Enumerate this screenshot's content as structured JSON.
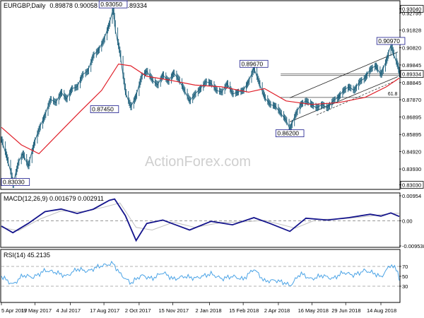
{
  "header": {
    "symbol": "EURGBP,Daily",
    "ohlc": "0.89878 0.90058 0.89125 0.89334"
  },
  "watermark": "ActionForex.com",
  "colors": {
    "background": "#ffffff",
    "bar": "#1b5e7a",
    "ema": "#e0202a",
    "macd_line": "#14148c",
    "macd_signal": "#c0c0c0",
    "rsi_line": "#4aa3e6",
    "trend": "#222222",
    "frame": "#000000",
    "text": "#000000",
    "label_box_border": "#1a1a8c"
  },
  "chart_data": [
    {
      "type": "candlestick",
      "title": "EURGBP,Daily",
      "ylim": [
        0.8285,
        0.9342
      ],
      "y_ticks": [
        "0.93040",
        "0.92795",
        "0.91828",
        "0.90820",
        "0.89845",
        "0.88845",
        "0.87870",
        "0.86895",
        "0.85895",
        "0.84920",
        "0.83930",
        "0.83030"
      ],
      "highlight_ticks": [
        "0.93040",
        "0.89334",
        "0.83030"
      ],
      "last_price": "0.89334",
      "annotations": [
        {
          "label": "0.93050",
          "date": "2017-08-29",
          "value": 0.9305
        },
        {
          "label": "0.87450",
          "date": "2017-09-07",
          "value": 0.8745
        },
        {
          "label": "0.89670",
          "date": "2018-03-01",
          "value": 0.8967
        },
        {
          "label": "0.86200",
          "date": "2018-04-17",
          "value": 0.862
        },
        {
          "label": "0.90970",
          "date": "2018-08-27",
          "value": 0.9097
        },
        {
          "label": "61.8",
          "date": "2018-09-05",
          "value": 0.88
        },
        {
          "label": "0.83030",
          "date": "2017-04-10",
          "value": 0.8303
        }
      ],
      "x_labels": [
        "5 Apr 2017",
        "19 May 2017",
        "4 Jul 2017",
        "17 Aug 2017",
        "2 Oct 2017",
        "15 Nov 2017",
        "2 Jan 2018",
        "15 Feb 2018",
        "2 Apr 2018",
        "16 May 2018",
        "29 Jun 2018",
        "14 Aug 2018"
      ],
      "x_range": [
        "2017-04-05",
        "2018-09-07"
      ],
      "series": [
        {
          "name": "Price",
          "points": [
            [
              "2017-04-05",
              0.856
            ],
            [
              "2017-04-10",
              0.849
            ],
            [
              "2017-04-17",
              0.838
            ],
            [
              "2017-04-20",
              0.8303
            ],
            [
              "2017-04-27",
              0.843
            ],
            [
              "2017-05-03",
              0.848
            ],
            [
              "2017-05-10",
              0.841
            ],
            [
              "2017-05-17",
              0.853
            ],
            [
              "2017-05-24",
              0.862
            ],
            [
              "2017-06-01",
              0.87
            ],
            [
              "2017-06-08",
              0.879
            ],
            [
              "2017-06-15",
              0.877
            ],
            [
              "2017-06-22",
              0.883
            ],
            [
              "2017-06-29",
              0.879
            ],
            [
              "2017-07-06",
              0.885
            ],
            [
              "2017-07-13",
              0.886
            ],
            [
              "2017-07-20",
              0.893
            ],
            [
              "2017-07-27",
              0.895
            ],
            [
              "2017-08-03",
              0.904
            ],
            [
              "2017-08-10",
              0.907
            ],
            [
              "2017-08-17",
              0.913
            ],
            [
              "2017-08-24",
              0.922
            ],
            [
              "2017-08-29",
              0.9305
            ],
            [
              "2017-09-01",
              0.918
            ],
            [
              "2017-09-07",
              0.905
            ],
            [
              "2017-09-14",
              0.883
            ],
            [
              "2017-09-21",
              0.8745
            ],
            [
              "2017-09-28",
              0.881
            ],
            [
              "2017-10-05",
              0.892
            ],
            [
              "2017-10-12",
              0.895
            ],
            [
              "2017-10-19",
              0.89
            ],
            [
              "2017-10-26",
              0.887
            ],
            [
              "2017-11-02",
              0.893
            ],
            [
              "2017-11-09",
              0.889
            ],
            [
              "2017-11-16",
              0.894
            ],
            [
              "2017-11-23",
              0.89
            ],
            [
              "2017-11-30",
              0.884
            ],
            [
              "2017-12-07",
              0.878
            ],
            [
              "2017-12-14",
              0.882
            ],
            [
              "2017-12-21",
              0.885
            ],
            [
              "2017-12-28",
              0.889
            ],
            [
              "2018-01-04",
              0.888
            ],
            [
              "2018-01-11",
              0.884
            ],
            [
              "2018-01-18",
              0.883
            ],
            [
              "2018-01-25",
              0.888
            ],
            [
              "2018-02-01",
              0.882
            ],
            [
              "2018-02-08",
              0.883
            ],
            [
              "2018-02-15",
              0.884
            ],
            [
              "2018-02-22",
              0.889
            ],
            [
              "2018-03-01",
              0.8967
            ],
            [
              "2018-03-08",
              0.888
            ],
            [
              "2018-03-15",
              0.88
            ],
            [
              "2018-03-22",
              0.876
            ],
            [
              "2018-03-29",
              0.875
            ],
            [
              "2018-04-05",
              0.871
            ],
            [
              "2018-04-12",
              0.867
            ],
            [
              "2018-04-17",
              0.862
            ],
            [
              "2018-04-24",
              0.87
            ],
            [
              "2018-05-01",
              0.876
            ],
            [
              "2018-05-08",
              0.878
            ],
            [
              "2018-05-15",
              0.876
            ],
            [
              "2018-05-22",
              0.874
            ],
            [
              "2018-05-29",
              0.876
            ],
            [
              "2018-06-05",
              0.874
            ],
            [
              "2018-06-12",
              0.878
            ],
            [
              "2018-06-19",
              0.88
            ],
            [
              "2018-06-26",
              0.884
            ],
            [
              "2018-07-03",
              0.886
            ],
            [
              "2018-07-10",
              0.884
            ],
            [
              "2018-07-17",
              0.889
            ],
            [
              "2018-07-24",
              0.891
            ],
            [
              "2018-07-31",
              0.896
            ],
            [
              "2018-08-07",
              0.898
            ],
            [
              "2018-08-14",
              0.893
            ],
            [
              "2018-08-21",
              0.901
            ],
            [
              "2018-08-27",
              0.9097
            ],
            [
              "2018-08-31",
              0.904
            ],
            [
              "2018-09-05",
              0.898
            ],
            [
              "2018-09-07",
              0.89334
            ]
          ]
        },
        {
          "name": "EMA",
          "points": [
            [
              "2017-04-05",
              0.863
            ],
            [
              "2017-05-01",
              0.853
            ],
            [
              "2017-05-24",
              0.848
            ],
            [
              "2017-06-20",
              0.86
            ],
            [
              "2017-07-17",
              0.872
            ],
            [
              "2017-08-14",
              0.884
            ],
            [
              "2017-09-05",
              0.899
            ],
            [
              "2017-09-21",
              0.898
            ],
            [
              "2017-10-12",
              0.892
            ],
            [
              "2017-11-09",
              0.89
            ],
            [
              "2017-12-14",
              0.887
            ],
            [
              "2018-01-18",
              0.886
            ],
            [
              "2018-02-22",
              0.883
            ],
            [
              "2018-03-15",
              0.885
            ],
            [
              "2018-04-12",
              0.878
            ],
            [
              "2018-05-15",
              0.876
            ],
            [
              "2018-06-19",
              0.877
            ],
            [
              "2018-07-24",
              0.88
            ],
            [
              "2018-08-21",
              0.886
            ],
            [
              "2018-09-07",
              0.891
            ]
          ]
        }
      ]
    },
    {
      "type": "line",
      "title": "MACD(12,26,9) 0.001679 0.002911",
      "ylim": [
        -0.009538,
        0.00954
      ],
      "y_ticks": [
        "0.00954",
        "0.00",
        "-0.009538"
      ],
      "series": [
        {
          "name": "MACD",
          "points": [
            [
              "2017-04-05",
              -0.002
            ],
            [
              "2017-04-20",
              -0.0045
            ],
            [
              "2017-05-10",
              -0.001
            ],
            [
              "2017-06-01",
              0.0035
            ],
            [
              "2017-06-22",
              0.0045
            ],
            [
              "2017-07-13",
              0.0028
            ],
            [
              "2017-08-03",
              0.0044
            ],
            [
              "2017-08-24",
              0.0078
            ],
            [
              "2017-08-31",
              0.0083
            ],
            [
              "2017-09-14",
              0.002
            ],
            [
              "2017-09-28",
              -0.0075
            ],
            [
              "2017-10-12",
              -0.001
            ],
            [
              "2017-11-02",
              0.0003
            ],
            [
              "2017-12-07",
              -0.0035
            ],
            [
              "2018-01-04",
              -0.0002
            ],
            [
              "2018-02-01",
              -0.0015
            ],
            [
              "2018-03-01",
              0.0012
            ],
            [
              "2018-03-22",
              -0.001
            ],
            [
              "2018-04-17",
              -0.004
            ],
            [
              "2018-05-08",
              0.001
            ],
            [
              "2018-06-05",
              0.0003
            ],
            [
              "2018-07-03",
              0.0012
            ],
            [
              "2018-07-31",
              0.0025
            ],
            [
              "2018-08-14",
              0.0018
            ],
            [
              "2018-08-27",
              0.003
            ],
            [
              "2018-09-07",
              0.001679
            ]
          ]
        },
        {
          "name": "Signal",
          "points": [
            [
              "2017-04-05",
              -0.0025
            ],
            [
              "2017-04-27",
              -0.0038
            ],
            [
              "2017-05-24",
              0.0005
            ],
            [
              "2017-06-22",
              0.0038
            ],
            [
              "2017-07-20",
              0.0035
            ],
            [
              "2017-08-17",
              0.0052
            ],
            [
              "2017-09-07",
              0.0068
            ],
            [
              "2017-09-28",
              -0.0025
            ],
            [
              "2017-10-19",
              -0.0035
            ],
            [
              "2017-11-16",
              -0.0005
            ],
            [
              "2017-12-14",
              -0.0025
            ],
            [
              "2018-01-18",
              -0.0006
            ],
            [
              "2018-02-15",
              -0.0004
            ],
            [
              "2018-03-15",
              0.0002
            ],
            [
              "2018-04-24",
              -0.0028
            ],
            [
              "2018-05-22",
              0.0005
            ],
            [
              "2018-06-26",
              0.0008
            ],
            [
              "2018-07-31",
              0.0018
            ],
            [
              "2018-08-27",
              0.0028
            ],
            [
              "2018-09-07",
              0.002911
            ]
          ]
        }
      ]
    },
    {
      "type": "line",
      "title": "RSI(14) 45.2135",
      "ylim": [
        0,
        100
      ],
      "y_ticks": [
        "70",
        "50",
        "30"
      ],
      "series": [
        {
          "name": "RSI",
          "points": [
            [
              "2017-04-05",
              50
            ],
            [
              "2017-04-20",
              33
            ],
            [
              "2017-05-03",
              52
            ],
            [
              "2017-05-17",
              48
            ],
            [
              "2017-06-01",
              62
            ],
            [
              "2017-06-15",
              58
            ],
            [
              "2017-06-29",
              50
            ],
            [
              "2017-07-13",
              65
            ],
            [
              "2017-07-27",
              60
            ],
            [
              "2017-08-10",
              70
            ],
            [
              "2017-08-29",
              76
            ],
            [
              "2017-09-07",
              55
            ],
            [
              "2017-09-21",
              36
            ],
            [
              "2017-10-05",
              52
            ],
            [
              "2017-10-19",
              45
            ],
            [
              "2017-11-02",
              58
            ],
            [
              "2017-11-16",
              44
            ],
            [
              "2017-11-30",
              50
            ],
            [
              "2017-12-14",
              46
            ],
            [
              "2018-01-04",
              55
            ],
            [
              "2018-01-18",
              45
            ],
            [
              "2018-02-01",
              50
            ],
            [
              "2018-02-15",
              44
            ],
            [
              "2018-03-01",
              65
            ],
            [
              "2018-03-15",
              40
            ],
            [
              "2018-03-29",
              42
            ],
            [
              "2018-04-12",
              36
            ],
            [
              "2018-04-17",
              30
            ],
            [
              "2018-05-01",
              56
            ],
            [
              "2018-05-15",
              44
            ],
            [
              "2018-05-29",
              52
            ],
            [
              "2018-06-12",
              45
            ],
            [
              "2018-06-26",
              58
            ],
            [
              "2018-07-10",
              52
            ],
            [
              "2018-07-24",
              62
            ],
            [
              "2018-08-07",
              55
            ],
            [
              "2018-08-14",
              48
            ],
            [
              "2018-08-27",
              74
            ],
            [
              "2018-09-05",
              60
            ],
            [
              "2018-09-07",
              45.2135
            ]
          ]
        }
      ]
    }
  ]
}
